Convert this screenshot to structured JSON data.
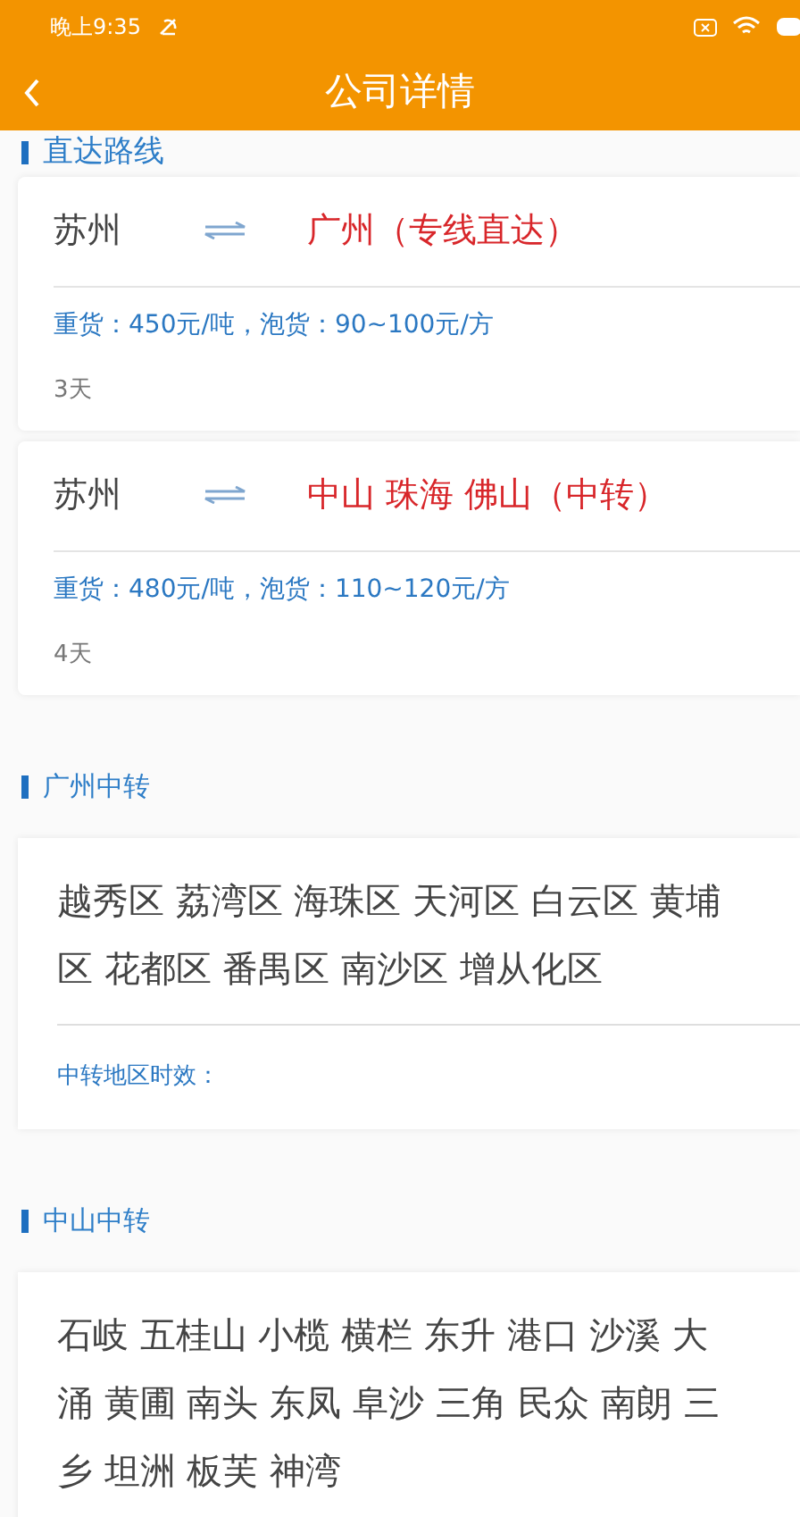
{
  "status_bar": {
    "time": "晚上9:35"
  },
  "header": {
    "title": "公司详情"
  },
  "routes_section": {
    "title": "直达路线",
    "routes": [
      {
        "from": "苏州",
        "to": "广州（专线直达）",
        "price": "重货：450元/吨，泡货：90~100元/方",
        "duration": "3天"
      },
      {
        "from": "苏州",
        "to": "中山 珠海 佛山（中转）",
        "price": "重货：480元/吨，泡货：110~120元/方",
        "duration": "4天"
      }
    ]
  },
  "transfer_sections": [
    {
      "title": "广州中转",
      "areas": "越秀区 荔湾区 海珠区 天河区 白云区 黄埔区 花都区 番禺区 南沙区 增从化区",
      "note": "中转地区时效："
    },
    {
      "title": "中山中转",
      "areas": "石岐 五桂山 小榄 横栏 东升 港口 沙溪 大涌 黄圃 南头 东凤 阜沙 三角 民众 南朗 三乡 坦洲 板芙 神湾"
    }
  ]
}
